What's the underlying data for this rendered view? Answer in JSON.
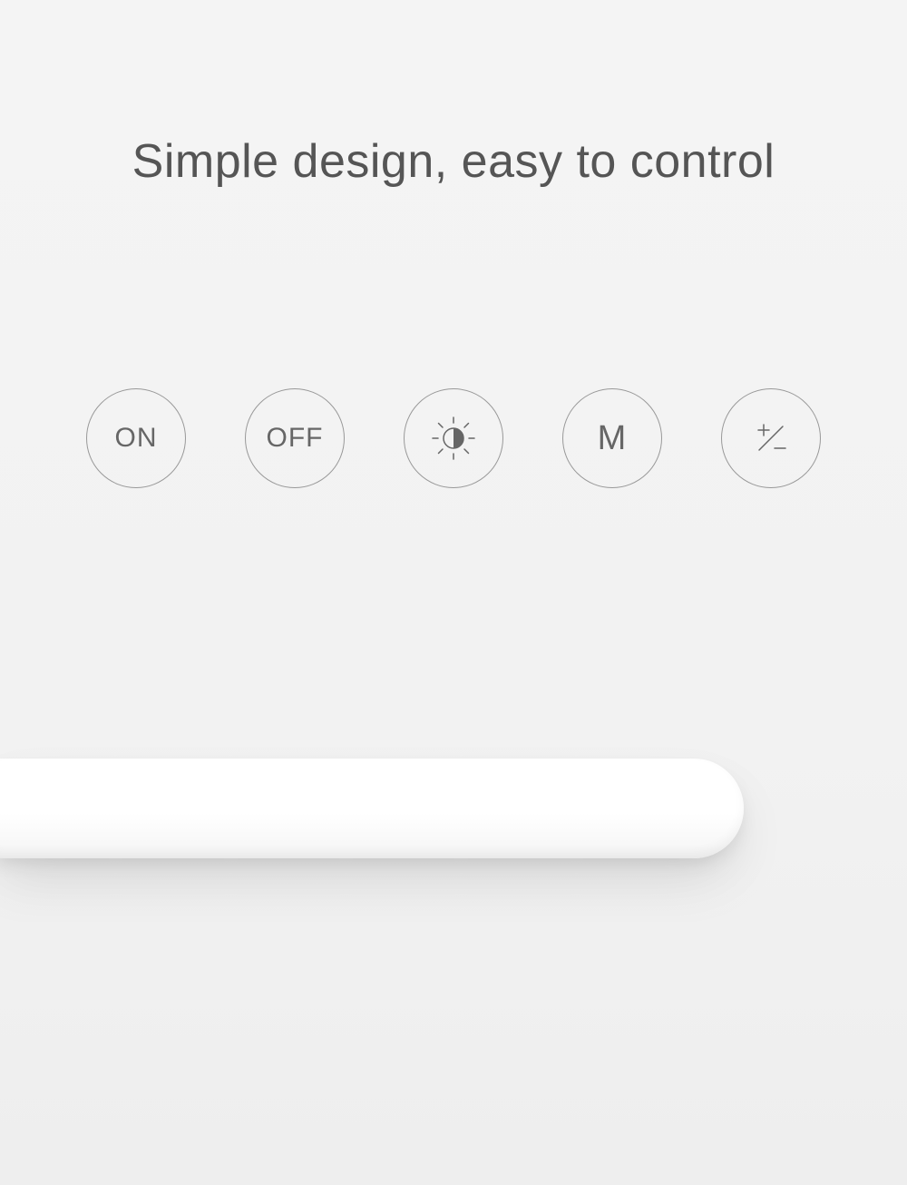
{
  "headline": "Simple design, easy to control",
  "buttons": {
    "on": {
      "label": "ON"
    },
    "off": {
      "label": "OFF"
    },
    "brightness": {
      "name": "brightness-icon"
    },
    "mode": {
      "label": "M"
    },
    "plusminus": {
      "name": "plus-minus-icon"
    }
  }
}
